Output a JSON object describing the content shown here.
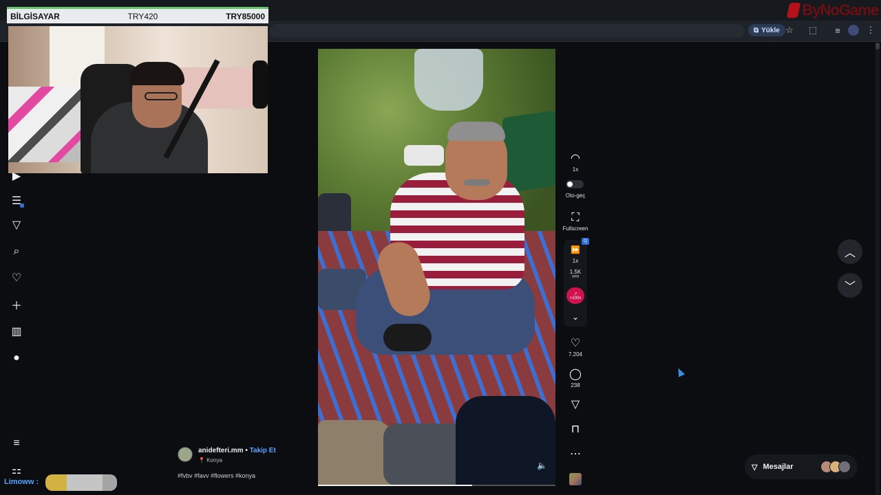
{
  "browser": {
    "upload_label": "Yükle",
    "icons": [
      "upload-icon",
      "star-icon",
      "extensions-icon",
      "playlist-icon",
      "profile-icon",
      "menu-dots-icon"
    ],
    "brand": "ByNoGame"
  },
  "stream_overlay": {
    "left_label": "BİLGİSAYAR",
    "mid_label": "TRY420",
    "right_label": "TRY85000",
    "accent": "#66c36b"
  },
  "sidebar": {
    "icons": [
      "video-icon",
      "playlist-icon",
      "send-icon",
      "search-icon",
      "heart-icon",
      "plus-icon",
      "analytics-icon",
      "avatar-icon"
    ],
    "bottom_icons": [
      "menu-icon",
      "apps-icon"
    ]
  },
  "chat": {
    "username": "Limoww :"
  },
  "post": {
    "author": "anidefteri.mm",
    "separator": "•",
    "follow_label": "Takip Et",
    "location": "Konya",
    "hashtags": "#fvbv #favv #flowers #konya",
    "progress": 0.65
  },
  "actions": {
    "speed_label": "1x",
    "autoplay_label": "Oto-geç",
    "fullscreen_label": "Fullscreen",
    "skip_speed_label": "1x",
    "skip_badge": "Q",
    "vph_value": "1.5K",
    "vph_label": "VPH",
    "trend_label": ">100x",
    "likes": "7.204",
    "comments": "238",
    "accent": "#d0134f"
  },
  "messages": {
    "label": "Mesajlar"
  }
}
